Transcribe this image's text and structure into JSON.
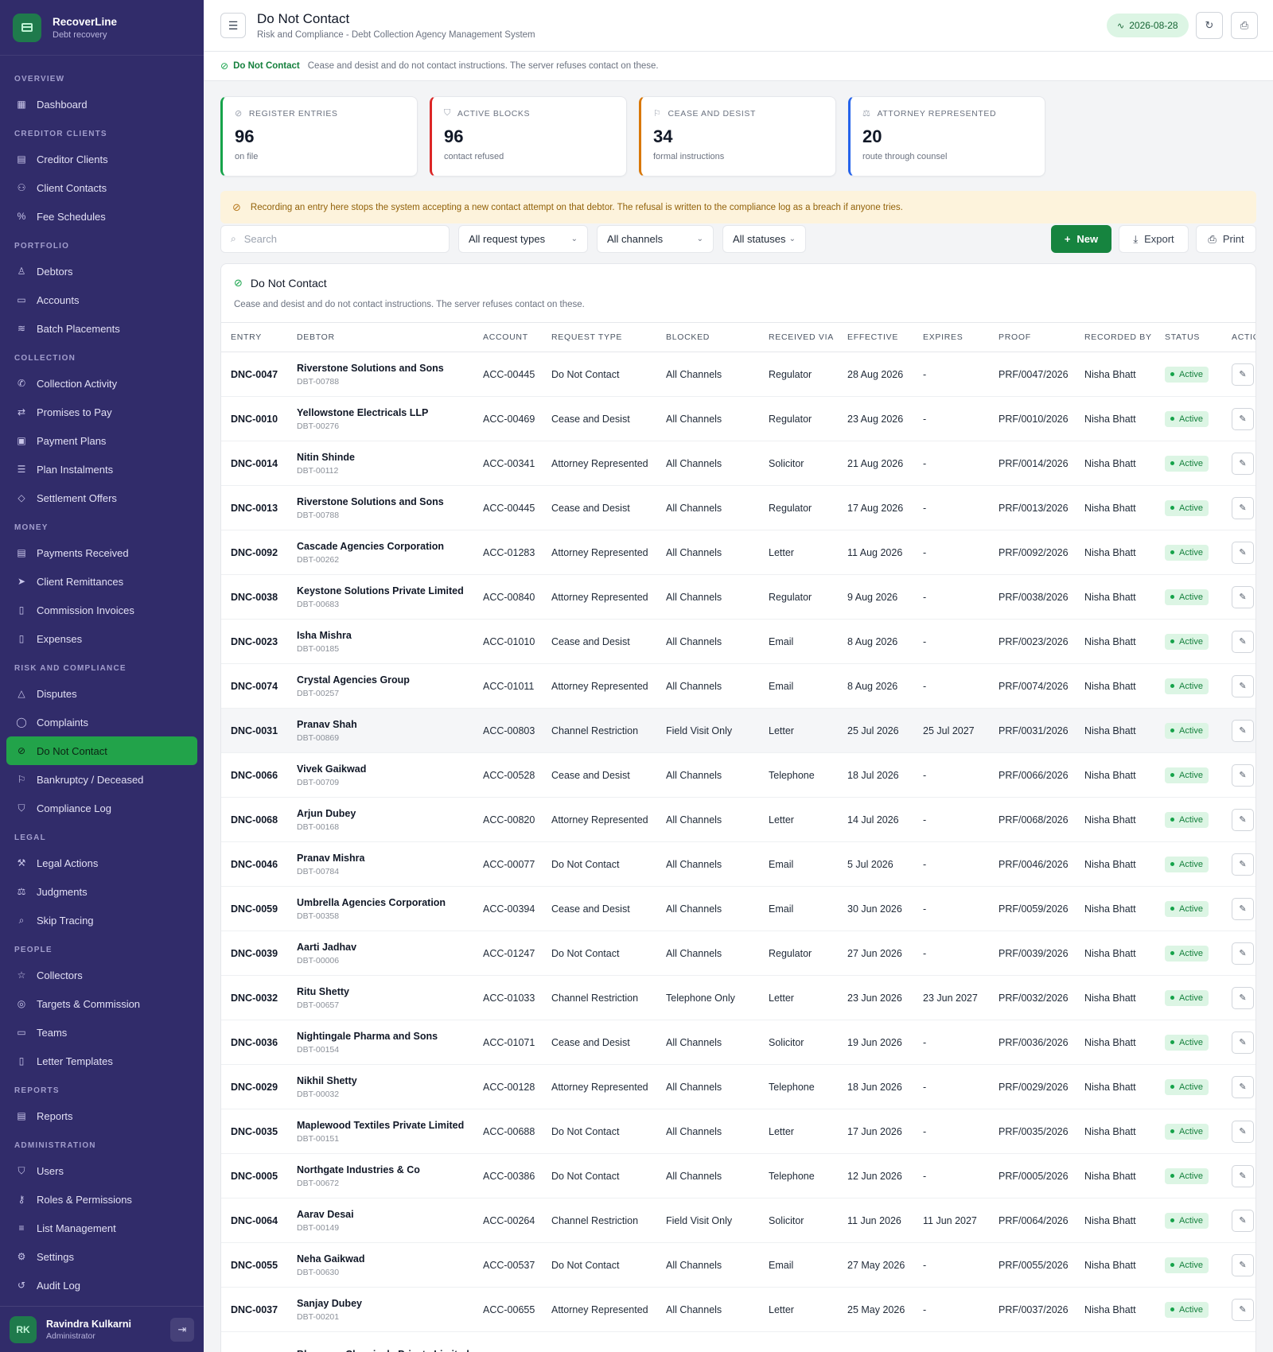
{
  "app": {
    "name": "RecoverLine",
    "tagline": "Debt recovery"
  },
  "nav": [
    {
      "section": "Overview",
      "items": [
        {
          "label": "Dashboard",
          "icon": "grid-icon",
          "glyph": "▦"
        }
      ]
    },
    {
      "section": "Creditor Clients",
      "items": [
        {
          "label": "Creditor Clients",
          "icon": "building-icon",
          "glyph": "▤"
        },
        {
          "label": "Client Contacts",
          "icon": "users-icon",
          "glyph": "⚇"
        },
        {
          "label": "Fee Schedules",
          "icon": "percent-icon",
          "glyph": "%"
        }
      ]
    },
    {
      "section": "Portfolio",
      "items": [
        {
          "label": "Debtors",
          "icon": "user-icon",
          "glyph": "♙"
        },
        {
          "label": "Accounts",
          "icon": "folder-icon",
          "glyph": "▭"
        },
        {
          "label": "Batch Placements",
          "icon": "layers-icon",
          "glyph": "≋"
        }
      ]
    },
    {
      "section": "Collection",
      "items": [
        {
          "label": "Collection Activity",
          "icon": "phone-icon",
          "glyph": "✆"
        },
        {
          "label": "Promises to Pay",
          "icon": "handshake-icon",
          "glyph": "⇄"
        },
        {
          "label": "Payment Plans",
          "icon": "calendar-icon",
          "glyph": "▣"
        },
        {
          "label": "Plan Instalments",
          "icon": "list-icon",
          "glyph": "☰"
        },
        {
          "label": "Settlement Offers",
          "icon": "tag-icon",
          "glyph": "◇"
        }
      ]
    },
    {
      "section": "Money",
      "items": [
        {
          "label": "Payments Received",
          "icon": "wallet-icon",
          "glyph": "▤"
        },
        {
          "label": "Client Remittances",
          "icon": "send-icon",
          "glyph": "➤"
        },
        {
          "label": "Commission Invoices",
          "icon": "invoice-icon",
          "glyph": "▯"
        },
        {
          "label": "Expenses",
          "icon": "receipt-icon",
          "glyph": "▯"
        }
      ]
    },
    {
      "section": "Risk and Compliance",
      "items": [
        {
          "label": "Disputes",
          "icon": "alert-triangle-icon",
          "glyph": "△"
        },
        {
          "label": "Complaints",
          "icon": "message-icon",
          "glyph": "◯"
        },
        {
          "label": "Do Not Contact",
          "icon": "ban-icon",
          "glyph": "⊘",
          "active": true
        },
        {
          "label": "Bankruptcy / Deceased",
          "icon": "flag-icon",
          "glyph": "⚐"
        },
        {
          "label": "Compliance Log",
          "icon": "shield-icon",
          "glyph": "⛉"
        }
      ]
    },
    {
      "section": "Legal",
      "items": [
        {
          "label": "Legal Actions",
          "icon": "gavel-icon",
          "glyph": "⚒"
        },
        {
          "label": "Judgments",
          "icon": "scale-icon",
          "glyph": "⚖"
        },
        {
          "label": "Skip Tracing",
          "icon": "search-icon",
          "glyph": "⌕"
        }
      ]
    },
    {
      "section": "People",
      "items": [
        {
          "label": "Collectors",
          "icon": "star-icon",
          "glyph": "☆"
        },
        {
          "label": "Targets & Commission",
          "icon": "target-icon",
          "glyph": "◎"
        },
        {
          "label": "Teams",
          "icon": "briefcase-icon",
          "glyph": "▭"
        },
        {
          "label": "Letter Templates",
          "icon": "file-icon",
          "glyph": "▯"
        }
      ]
    },
    {
      "section": "Reports",
      "items": [
        {
          "label": "Reports",
          "icon": "report-icon",
          "glyph": "▤"
        }
      ]
    },
    {
      "section": "Administration",
      "items": [
        {
          "label": "Users",
          "icon": "user-shield-icon",
          "glyph": "⛉"
        },
        {
          "label": "Roles & Permissions",
          "icon": "key-icon",
          "glyph": "⚷"
        },
        {
          "label": "List Management",
          "icon": "sliders-icon",
          "glyph": "≡"
        },
        {
          "label": "Settings",
          "icon": "gear-icon",
          "glyph": "⚙"
        },
        {
          "label": "Audit Log",
          "icon": "history-icon",
          "glyph": "↺"
        }
      ]
    }
  ],
  "user": {
    "initials": "RK",
    "name": "Ravindra Kulkarni",
    "role": "Administrator"
  },
  "header": {
    "title": "Do Not Contact",
    "subtitle": "Risk and Compliance - Debt Collection Agency Management System",
    "date": "2026-08-28"
  },
  "info_strip": {
    "label": "Do Not Contact",
    "description": "Cease and desist and do not contact instructions. The server refuses contact on these."
  },
  "stats": [
    {
      "label": "Register Entries",
      "value": "96",
      "sub": "on file",
      "icon": "ban-icon",
      "glyph": "⊘",
      "color": "#16a34a"
    },
    {
      "label": "Active Blocks",
      "value": "96",
      "sub": "contact refused",
      "icon": "shield-icon",
      "glyph": "⛉",
      "color": "#dc2626"
    },
    {
      "label": "Cease and Desist",
      "value": "34",
      "sub": "formal instructions",
      "icon": "flag-icon",
      "glyph": "⚐",
      "color": "#d97706"
    },
    {
      "label": "Attorney Represented",
      "value": "20",
      "sub": "route through counsel",
      "icon": "scale-icon",
      "glyph": "⚖",
      "color": "#2563eb"
    }
  ],
  "warning": "Recording an entry here stops the system accepting a new contact attempt on that debtor. The refusal is written to the compliance log as a breach if anyone tries.",
  "toolbar": {
    "search_placeholder": "Search",
    "filter_type": "All request types",
    "filter_channel": "All channels",
    "filter_status": "All statuses",
    "new_label": "New",
    "export_label": "Export",
    "print_label": "Print"
  },
  "table": {
    "title": "Do Not Contact",
    "description": "Cease and desist and do not contact instructions. The server refuses contact on these.",
    "columns": [
      "Entry",
      "Debtor",
      "Account",
      "Request Type",
      "Blocked",
      "Received Via",
      "Effective",
      "Expires",
      "Proof",
      "Recorded By",
      "Status",
      "Actions"
    ],
    "rows": [
      {
        "entry": "DNC-0047",
        "debtor": "Riverstone Solutions and Sons",
        "code": "DBT-00788",
        "account": "ACC-00445",
        "type": "Do Not Contact",
        "blocked": "All Channels",
        "via": "Regulator",
        "effective": "28 Aug 2026",
        "expires": "-",
        "proof": "PRF/0047/2026",
        "by": "Nisha Bhatt",
        "status": "Active"
      },
      {
        "entry": "DNC-0010",
        "debtor": "Yellowstone Electricals LLP",
        "code": "DBT-00276",
        "account": "ACC-00469",
        "type": "Cease and Desist",
        "blocked": "All Channels",
        "via": "Regulator",
        "effective": "23 Aug 2026",
        "expires": "-",
        "proof": "PRF/0010/2026",
        "by": "Nisha Bhatt",
        "status": "Active"
      },
      {
        "entry": "DNC-0014",
        "debtor": "Nitin Shinde",
        "code": "DBT-00112",
        "account": "ACC-00341",
        "type": "Attorney Represented",
        "blocked": "All Channels",
        "via": "Solicitor",
        "effective": "21 Aug 2026",
        "expires": "-",
        "proof": "PRF/0014/2026",
        "by": "Nisha Bhatt",
        "status": "Active"
      },
      {
        "entry": "DNC-0013",
        "debtor": "Riverstone Solutions and Sons",
        "code": "DBT-00788",
        "account": "ACC-00445",
        "type": "Cease and Desist",
        "blocked": "All Channels",
        "via": "Regulator",
        "effective": "17 Aug 2026",
        "expires": "-",
        "proof": "PRF/0013/2026",
        "by": "Nisha Bhatt",
        "status": "Active"
      },
      {
        "entry": "DNC-0092",
        "debtor": "Cascade Agencies Corporation",
        "code": "DBT-00262",
        "account": "ACC-01283",
        "type": "Attorney Represented",
        "blocked": "All Channels",
        "via": "Letter",
        "effective": "11 Aug 2026",
        "expires": "-",
        "proof": "PRF/0092/2026",
        "by": "Nisha Bhatt",
        "status": "Active"
      },
      {
        "entry": "DNC-0038",
        "debtor": "Keystone Solutions Private Limited",
        "code": "DBT-00683",
        "account": "ACC-00840",
        "type": "Attorney Represented",
        "blocked": "All Channels",
        "via": "Regulator",
        "effective": "9 Aug 2026",
        "expires": "-",
        "proof": "PRF/0038/2026",
        "by": "Nisha Bhatt",
        "status": "Active"
      },
      {
        "entry": "DNC-0023",
        "debtor": "Isha Mishra",
        "code": "DBT-00185",
        "account": "ACC-01010",
        "type": "Cease and Desist",
        "blocked": "All Channels",
        "via": "Email",
        "effective": "8 Aug 2026",
        "expires": "-",
        "proof": "PRF/0023/2026",
        "by": "Nisha Bhatt",
        "status": "Active"
      },
      {
        "entry": "DNC-0074",
        "debtor": "Crystal Agencies Group",
        "code": "DBT-00257",
        "account": "ACC-01011",
        "type": "Attorney Represented",
        "blocked": "All Channels",
        "via": "Email",
        "effective": "8 Aug 2026",
        "expires": "-",
        "proof": "PRF/0074/2026",
        "by": "Nisha Bhatt",
        "status": "Active"
      },
      {
        "entry": "DNC-0031",
        "debtor": "Pranav Shah",
        "code": "DBT-00869",
        "account": "ACC-00803",
        "type": "Channel Restriction",
        "blocked": "Field Visit Only",
        "via": "Letter",
        "effective": "25 Jul 2026",
        "expires": "25 Jul 2027",
        "proof": "PRF/0031/2026",
        "by": "Nisha Bhatt",
        "status": "Active",
        "highlight": true
      },
      {
        "entry": "DNC-0066",
        "debtor": "Vivek Gaikwad",
        "code": "DBT-00709",
        "account": "ACC-00528",
        "type": "Cease and Desist",
        "blocked": "All Channels",
        "via": "Telephone",
        "effective": "18 Jul 2026",
        "expires": "-",
        "proof": "PRF/0066/2026",
        "by": "Nisha Bhatt",
        "status": "Active"
      },
      {
        "entry": "DNC-0068",
        "debtor": "Arjun Dubey",
        "code": "DBT-00168",
        "account": "ACC-00820",
        "type": "Attorney Represented",
        "blocked": "All Channels",
        "via": "Letter",
        "effective": "14 Jul 2026",
        "expires": "-",
        "proof": "PRF/0068/2026",
        "by": "Nisha Bhatt",
        "status": "Active"
      },
      {
        "entry": "DNC-0046",
        "debtor": "Pranav Mishra",
        "code": "DBT-00784",
        "account": "ACC-00077",
        "type": "Do Not Contact",
        "blocked": "All Channels",
        "via": "Email",
        "effective": "5 Jul 2026",
        "expires": "-",
        "proof": "PRF/0046/2026",
        "by": "Nisha Bhatt",
        "status": "Active"
      },
      {
        "entry": "DNC-0059",
        "debtor": "Umbrella Agencies Corporation",
        "code": "DBT-00358",
        "account": "ACC-00394",
        "type": "Cease and Desist",
        "blocked": "All Channels",
        "via": "Email",
        "effective": "30 Jun 2026",
        "expires": "-",
        "proof": "PRF/0059/2026",
        "by": "Nisha Bhatt",
        "status": "Active"
      },
      {
        "entry": "DNC-0039",
        "debtor": "Aarti Jadhav",
        "code": "DBT-00006",
        "account": "ACC-01247",
        "type": "Do Not Contact",
        "blocked": "All Channels",
        "via": "Regulator",
        "effective": "27 Jun 2026",
        "expires": "-",
        "proof": "PRF/0039/2026",
        "by": "Nisha Bhatt",
        "status": "Active"
      },
      {
        "entry": "DNC-0032",
        "debtor": "Ritu Shetty",
        "code": "DBT-00657",
        "account": "ACC-01033",
        "type": "Channel Restriction",
        "blocked": "Telephone Only",
        "via": "Letter",
        "effective": "23 Jun 2026",
        "expires": "23 Jun 2027",
        "proof": "PRF/0032/2026",
        "by": "Nisha Bhatt",
        "status": "Active"
      },
      {
        "entry": "DNC-0036",
        "debtor": "Nightingale Pharma and Sons",
        "code": "DBT-00154",
        "account": "ACC-01071",
        "type": "Cease and Desist",
        "blocked": "All Channels",
        "via": "Solicitor",
        "effective": "19 Jun 2026",
        "expires": "-",
        "proof": "PRF/0036/2026",
        "by": "Nisha Bhatt",
        "status": "Active"
      },
      {
        "entry": "DNC-0029",
        "debtor": "Nikhil Shetty",
        "code": "DBT-00032",
        "account": "ACC-00128",
        "type": "Attorney Represented",
        "blocked": "All Channels",
        "via": "Telephone",
        "effective": "18 Jun 2026",
        "expires": "-",
        "proof": "PRF/0029/2026",
        "by": "Nisha Bhatt",
        "status": "Active"
      },
      {
        "entry": "DNC-0035",
        "debtor": "Maplewood Textiles Private Limited",
        "code": "DBT-00151",
        "account": "ACC-00688",
        "type": "Do Not Contact",
        "blocked": "All Channels",
        "via": "Letter",
        "effective": "17 Jun 2026",
        "expires": "-",
        "proof": "PRF/0035/2026",
        "by": "Nisha Bhatt",
        "status": "Active"
      },
      {
        "entry": "DNC-0005",
        "debtor": "Northgate Industries & Co",
        "code": "DBT-00672",
        "account": "ACC-00386",
        "type": "Do Not Contact",
        "blocked": "All Channels",
        "via": "Telephone",
        "effective": "12 Jun 2026",
        "expires": "-",
        "proof": "PRF/0005/2026",
        "by": "Nisha Bhatt",
        "status": "Active"
      },
      {
        "entry": "DNC-0064",
        "debtor": "Aarav Desai",
        "code": "DBT-00149",
        "account": "ACC-00264",
        "type": "Channel Restriction",
        "blocked": "Field Visit Only",
        "via": "Solicitor",
        "effective": "11 Jun 2026",
        "expires": "11 Jun 2027",
        "proof": "PRF/0064/2026",
        "by": "Nisha Bhatt",
        "status": "Active"
      },
      {
        "entry": "DNC-0055",
        "debtor": "Neha Gaikwad",
        "code": "DBT-00630",
        "account": "ACC-00537",
        "type": "Do Not Contact",
        "blocked": "All Channels",
        "via": "Email",
        "effective": "27 May 2026",
        "expires": "-",
        "proof": "PRF/0055/2026",
        "by": "Nisha Bhatt",
        "status": "Active"
      },
      {
        "entry": "DNC-0037",
        "debtor": "Sanjay Dubey",
        "code": "DBT-00201",
        "account": "ACC-00655",
        "type": "Attorney Represented",
        "blocked": "All Channels",
        "via": "Letter",
        "effective": "25 May 2026",
        "expires": "-",
        "proof": "PRF/0037/2026",
        "by": "Nisha Bhatt",
        "status": "Active"
      },
      {
        "entry": "",
        "debtor": "Bluewave Chemicals Private Limited",
        "code": "",
        "account": "",
        "type": "",
        "blocked": "",
        "via": "",
        "effective": "",
        "expires": "",
        "proof": "",
        "by": "",
        "status": ""
      }
    ]
  }
}
